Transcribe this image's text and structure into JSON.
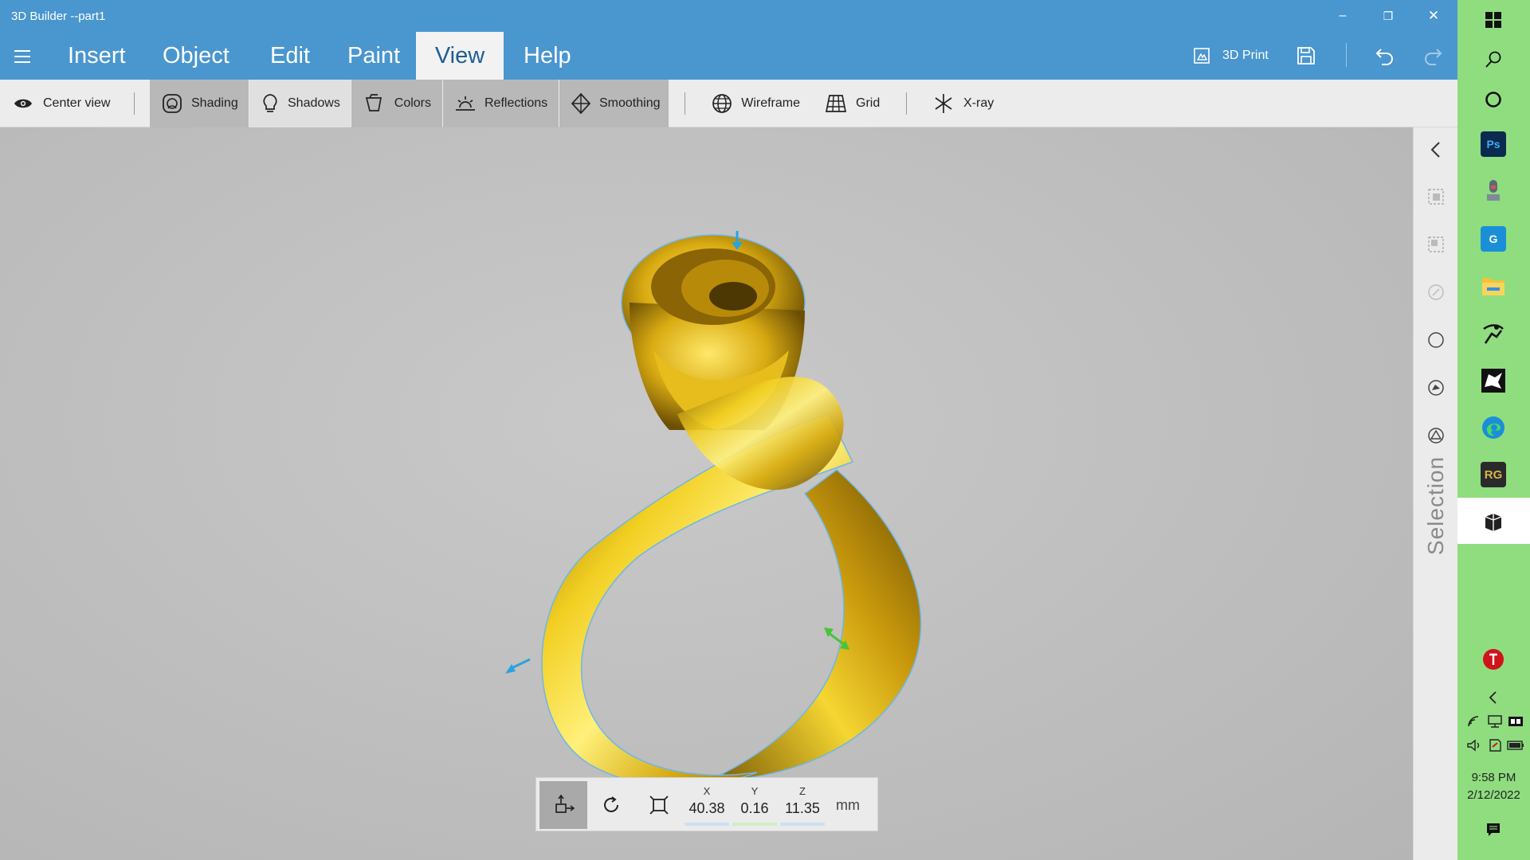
{
  "window": {
    "title": "3D Builder --part1",
    "minimize": "–",
    "restore": "❐",
    "close": "✕"
  },
  "menu": {
    "tabs": [
      {
        "label": "Insert"
      },
      {
        "label": "Object"
      },
      {
        "label": "Edit"
      },
      {
        "label": "Paint"
      },
      {
        "label": "View",
        "active": true
      },
      {
        "label": "Help"
      }
    ],
    "print_label": "3D Print"
  },
  "ribbon": {
    "items": [
      {
        "label": "Center view",
        "icon": "eye-icon",
        "active": false
      },
      {
        "label": "Shading",
        "icon": "shading-icon",
        "active": true
      },
      {
        "label": "Shadows",
        "icon": "lightbulb-icon",
        "active": true
      },
      {
        "label": "Colors",
        "icon": "paint-bucket-icon",
        "active": true
      },
      {
        "label": "Reflections",
        "icon": "sunrise-icon",
        "active": true
      },
      {
        "label": "Smoothing",
        "icon": "diamond-icon",
        "active": true
      },
      {
        "label": "Wireframe",
        "icon": "globe-icon",
        "active": false
      },
      {
        "label": "Grid",
        "icon": "grid-icon",
        "active": false
      },
      {
        "label": "X-ray",
        "icon": "asterisk-icon",
        "active": false
      }
    ]
  },
  "coords": {
    "x_label": "X",
    "x": "40.38",
    "y_label": "Y",
    "y": "0.16",
    "z_label": "Z",
    "z": "11.35",
    "unit": "mm",
    "colors": {
      "x": "#cfe0ef",
      "y": "#d3ecc8",
      "z": "#cfe0ef"
    }
  },
  "side_panel": {
    "label": "Selection"
  },
  "taskbar": {
    "apps": [
      {
        "name": "photoshop-icon",
        "text": "Ps",
        "color": "#0b2a4f",
        "fg": "#3fa9f5"
      },
      {
        "name": "microphone-icon",
        "text": "",
        "color": "#6e7b86",
        "fg": "#ffffff"
      },
      {
        "name": "grammarly-icon",
        "text": "G",
        "color": "#1a8fd8",
        "fg": "#ffffff"
      },
      {
        "name": "file-explorer-icon",
        "text": "",
        "color": "#f2c23a",
        "fg": "#ffffff"
      },
      {
        "name": "zbrush-icon",
        "text": "",
        "color": "#1c1c1c",
        "fg": "#ffffff"
      },
      {
        "name": "rhino-icon",
        "text": "",
        "color": "#1c1c1c",
        "fg": "#ffffff"
      },
      {
        "name": "edge-icon",
        "text": "",
        "color": "#1b8ed8",
        "fg": "#ffffff"
      },
      {
        "name": "rhinogold-icon",
        "text": "RG",
        "color": "#2a2a2a",
        "fg": "#d8b44a"
      },
      {
        "name": "3d-builder-icon",
        "text": "",
        "color": "#ffffff",
        "fg": "#222222"
      },
      {
        "name": "red-app-icon",
        "text": "",
        "color": "#d0121b",
        "fg": "#ffffff"
      }
    ],
    "time": "9:58 PM",
    "date": "2/12/2022"
  }
}
